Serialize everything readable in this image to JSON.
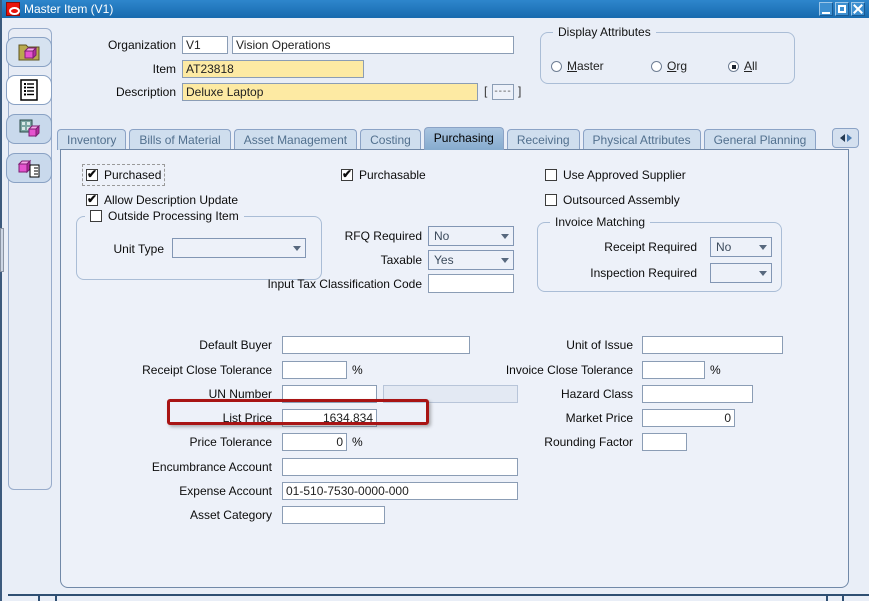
{
  "window": {
    "title": "Master Item (V1)"
  },
  "header": {
    "organization_label": "Organization",
    "organization_code": "V1",
    "organization_name": "Vision Operations",
    "item_label": "Item",
    "item_value": "AT23818",
    "description_label": "Description",
    "description_value": "Deluxe Laptop",
    "flexfield": {
      "open": "[",
      "dashes": "----",
      "close": "]"
    }
  },
  "display_attributes": {
    "title": "Display Attributes",
    "options": [
      {
        "label": "Master",
        "selected": false
      },
      {
        "label": "Org",
        "selected": false
      },
      {
        "label": "All",
        "selected": true
      }
    ]
  },
  "tabs": {
    "items": [
      {
        "label": "Inventory",
        "active": false
      },
      {
        "label": "Bills of Material",
        "active": false
      },
      {
        "label": "Asset Management",
        "active": false
      },
      {
        "label": "Costing",
        "active": false
      },
      {
        "label": "Purchasing",
        "active": true
      },
      {
        "label": "Receiving",
        "active": false
      },
      {
        "label": "Physical Attributes",
        "active": false
      },
      {
        "label": "General Planning",
        "active": false
      }
    ]
  },
  "purchasing": {
    "checkboxes": [
      {
        "label": "Purchased",
        "checked": true
      },
      {
        "label": "Purchasable",
        "checked": true
      },
      {
        "label": "Use Approved Supplier",
        "checked": false
      },
      {
        "label": "Allow Description Update",
        "checked": true
      },
      {
        "label": "Outsourced Assembly",
        "checked": false
      }
    ],
    "outside_processing": {
      "title": "Outside Processing Item",
      "checked": false,
      "unit_type_label": "Unit Type",
      "unit_type_value": ""
    },
    "rfq_required_label": "RFQ Required",
    "rfq_required_value": "No",
    "taxable_label": "Taxable",
    "taxable_value": "Yes",
    "input_tax_label": "Input Tax Classification Code",
    "input_tax_value": "",
    "invoice_matching": {
      "title": "Invoice Matching",
      "receipt_required_label": "Receipt Required",
      "receipt_required_value": "No",
      "inspection_required_label": "Inspection Required",
      "inspection_required_value": ""
    },
    "left_fields": {
      "default_buyer": {
        "label": "Default Buyer",
        "value": ""
      },
      "receipt_close_tolerance": {
        "label": "Receipt Close Tolerance",
        "value": "",
        "suffix": "%"
      },
      "un_number": {
        "label": "UN Number",
        "value": "",
        "secondary_value": ""
      },
      "list_price": {
        "label": "List Price",
        "value": "1634.834",
        "highlighted": true
      },
      "price_tolerance": {
        "label": "Price Tolerance",
        "value": "0",
        "suffix": "%"
      },
      "encumbrance_account": {
        "label": "Encumbrance Account",
        "value": ""
      },
      "expense_account": {
        "label": "Expense Account",
        "value": "01-510-7530-0000-000"
      },
      "asset_category": {
        "label": "Asset Category",
        "value": ""
      }
    },
    "right_fields": {
      "unit_of_issue": {
        "label": "Unit of Issue",
        "value": ""
      },
      "invoice_close_tolerance": {
        "label": "Invoice Close Tolerance",
        "value": "",
        "suffix": "%"
      },
      "hazard_class": {
        "label": "Hazard Class",
        "value": ""
      },
      "market_price": {
        "label": "Market Price",
        "value": "0"
      },
      "rounding_factor": {
        "label": "Rounding Factor",
        "value": ""
      }
    }
  }
}
